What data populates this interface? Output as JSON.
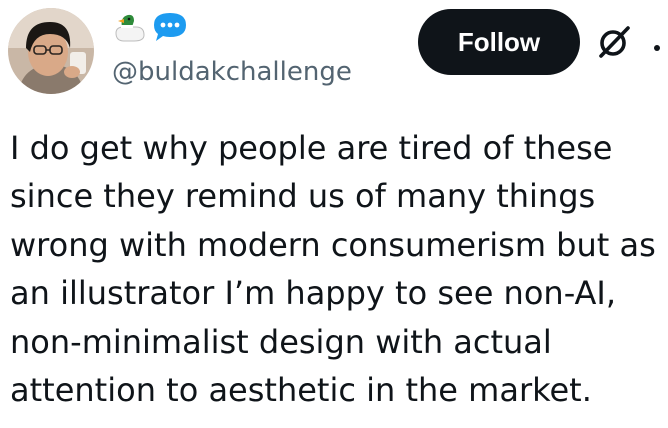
{
  "author": {
    "handle": "@buldakchallenge",
    "avatar_icon": "avatar-photo",
    "badges": [
      "duck-emoji-icon",
      "speech-bubble-icon"
    ]
  },
  "actions": {
    "follow_label": "Follow",
    "grok_icon": "grok-icon",
    "more_icon": "more-icon"
  },
  "tweet": {
    "text": "I do get why people are tired of these\nsince they remind us of many things\nwrong with modern consumerism but as\nan illustrator I’m happy to see non-AI,\nnon-minimalist design with actual\nattention to aesthetic in the market."
  },
  "colors": {
    "text": "#0f1419",
    "secondary": "#536471",
    "button_bg": "#0f1419",
    "bubble_blue": "#1d9bf0"
  }
}
